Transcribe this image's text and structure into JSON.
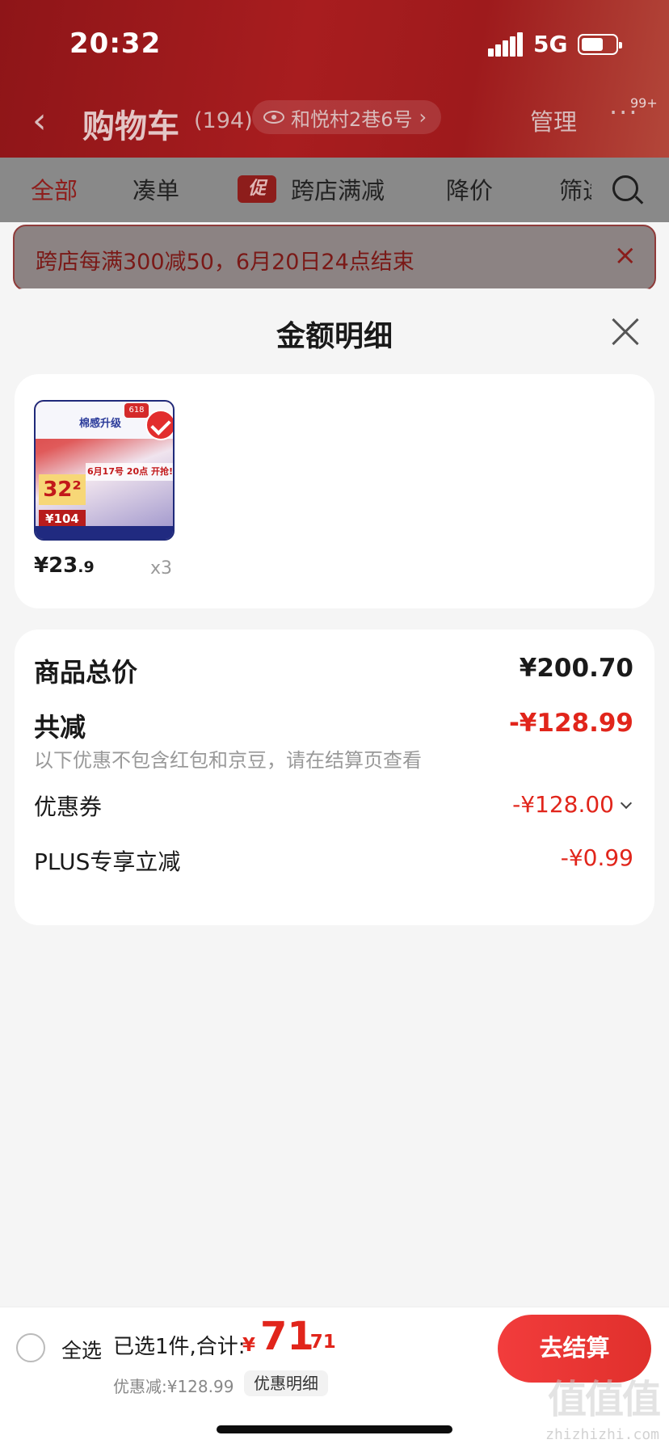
{
  "status": {
    "time": "20:32",
    "network": "5G"
  },
  "nav": {
    "title": "购物车",
    "count": "(194)",
    "address": "和悦村2巷6号",
    "address_chevron": "›",
    "manage_label": "管理",
    "more_badge": "99+"
  },
  "tabs": [
    {
      "label": "全部",
      "active": true
    },
    {
      "label": "凑单"
    },
    {
      "label": "跨店满减",
      "tag": "促"
    },
    {
      "label": "降价"
    },
    {
      "label": "筛选"
    }
  ],
  "promo_banner": {
    "text": "跨店每满300减50，6月20日24点结束",
    "close": "×"
  },
  "sheet": {
    "title": "金额明细",
    "goods": [
      {
        "price_symbol": "¥",
        "price_int": "23",
        "price_dec": ".9",
        "quantity": "x3",
        "thumb": {
          "headline": "棉感升级",
          "badge": "618",
          "price_tag": "32²",
          "promo_date": "6月17号 20点 开抢!",
          "price_tag2": "¥104"
        }
      }
    ],
    "summary": {
      "total_label": "商品总价",
      "total_value": "¥200.70",
      "reduce_label": "共减",
      "reduce_value": "-¥128.99",
      "reduce_note": "以下优惠不包含红包和京豆，请在结算页查看",
      "coupon_label": "优惠券",
      "coupon_value": "-¥128.00",
      "plus_label": "PLUS专享立减",
      "plus_value": "-¥0.99"
    }
  },
  "bottom_bar": {
    "select_all": "全选",
    "selected_text": "已选1件,合计:",
    "total_symbol": "¥",
    "total_int": "71",
    "total_dec": ".71",
    "discount_text": "优惠减:¥128.99",
    "detail_label": "优惠明细",
    "checkout_label": "去结算"
  },
  "watermark": {
    "logo": "值值值",
    "site": "zhizhizhi.com"
  },
  "colors": {
    "accent_red": "#e1251b",
    "header_red": "#a81d1f",
    "checkout_red": "#f23c3c"
  }
}
